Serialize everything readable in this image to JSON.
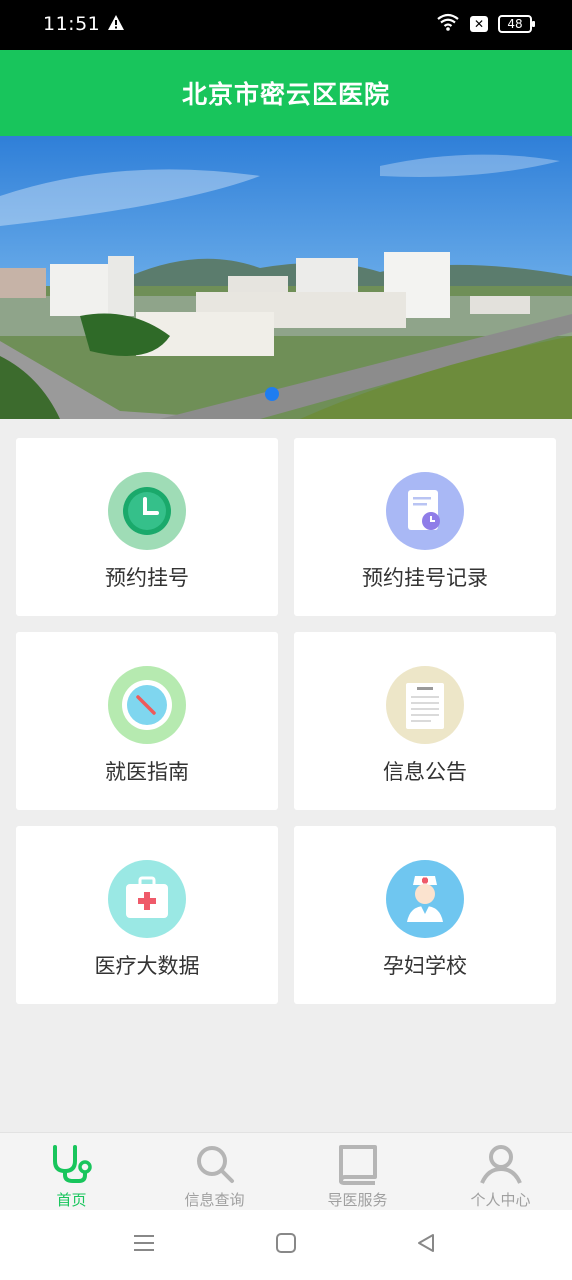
{
  "status_bar": {
    "time": "11:51",
    "battery": "48"
  },
  "header": {
    "title": "北京市密云区医院"
  },
  "banner": {
    "image": "hospital-aerial-photo"
  },
  "menu": [
    {
      "label": "预约挂号",
      "icon": "clock-icon",
      "color": "#9fdcb6"
    },
    {
      "label": "预约挂号记录",
      "icon": "document-clock-icon",
      "color": "#a9b8f5"
    },
    {
      "label": "就医指南",
      "icon": "compass-icon",
      "color": "#b6eab0"
    },
    {
      "label": "信息公告",
      "icon": "notice-icon",
      "color": "#ede6c8"
    },
    {
      "label": "医疗大数据",
      "icon": "medical-kit-icon",
      "color": "#9ae8e4"
    },
    {
      "label": "孕妇学校",
      "icon": "nurse-icon",
      "color": "#6fc6f0"
    }
  ],
  "tabbar": [
    {
      "label": "首页",
      "icon": "stethoscope-icon",
      "active": true
    },
    {
      "label": "信息查询",
      "icon": "search-icon",
      "active": false
    },
    {
      "label": "导医服务",
      "icon": "book-icon",
      "active": false
    },
    {
      "label": "个人中心",
      "icon": "person-icon",
      "active": false
    }
  ],
  "accent_color": "#18c55c"
}
